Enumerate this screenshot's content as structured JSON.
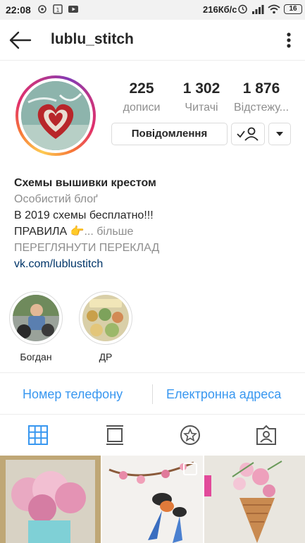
{
  "status_bar": {
    "time": "22:08",
    "network_speed": "216Кб/с",
    "battery": "16"
  },
  "header": {
    "username": "lublu_stitch"
  },
  "stats": [
    {
      "value": "225",
      "label": "дописи"
    },
    {
      "value": "1 302",
      "label": "Читачі"
    },
    {
      "value": "1 876",
      "label": "Відстежу..."
    }
  ],
  "actions": {
    "message_label": "Повідомлення"
  },
  "bio": {
    "name": "Схемы вышивки крестом",
    "category": "Особистий блоґ",
    "line1": "В 2019 схемы бесплатно!!!",
    "line2": "ПРАВИЛА 👉",
    "more": "... більше",
    "translate": "ПЕРЕГЛЯНУТИ ПЕРЕКЛАД",
    "link": "vk.com/lublustitch"
  },
  "highlights": [
    {
      "label": "Богдан"
    },
    {
      "label": "ДР"
    }
  ],
  "contact": {
    "phone": "Номер телефону",
    "email": "Електронна адреса"
  },
  "tabs": [
    "grid-icon",
    "feed-icon",
    "star-icon",
    "tagged-icon"
  ],
  "colors": {
    "link_blue": "#3897f0",
    "active_tab": "#3897f0",
    "muted": "#8e8e8e"
  }
}
